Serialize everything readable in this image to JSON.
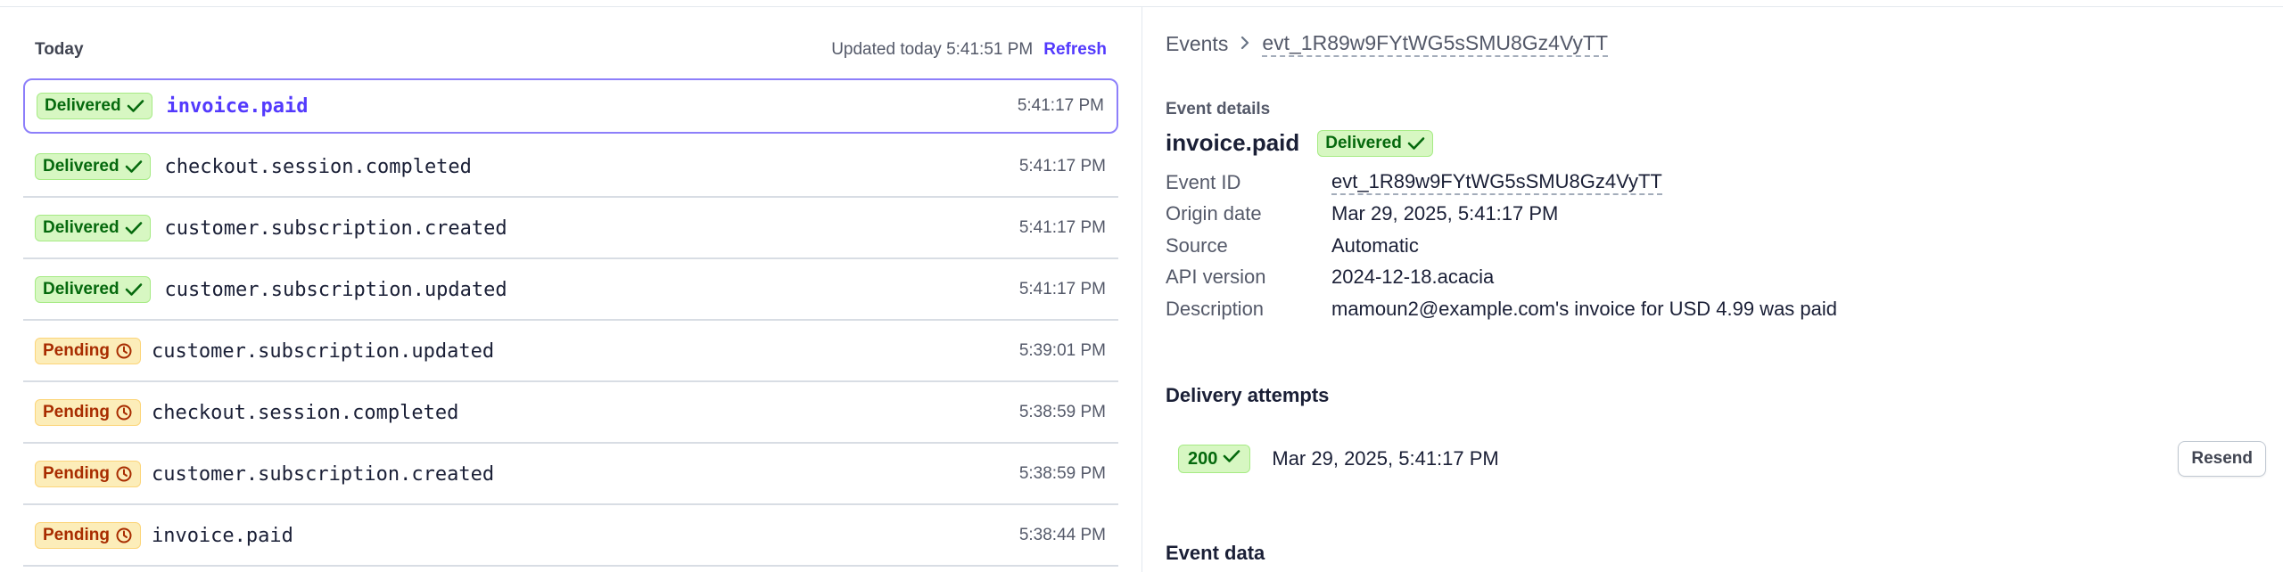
{
  "colors": {
    "accent": "#533afd",
    "delivered_bg": "#d7f7c2",
    "delivered_text": "#05690d",
    "pending_bg": "#fcedb9",
    "pending_text": "#a82c00",
    "selected_border": "#8d7ffa"
  },
  "list": {
    "section_title": "Today",
    "updated_text": "Updated today 5:41:51 PM",
    "refresh_label": "Refresh",
    "events": [
      {
        "status": "Delivered",
        "status_icon": "check-icon",
        "type": "invoice.paid",
        "time": "5:41:17 PM",
        "selected": true
      },
      {
        "status": "Delivered",
        "status_icon": "check-icon",
        "type": "checkout.session.completed",
        "time": "5:41:17 PM",
        "selected": false
      },
      {
        "status": "Delivered",
        "status_icon": "check-icon",
        "type": "customer.subscription.created",
        "time": "5:41:17 PM",
        "selected": false
      },
      {
        "status": "Delivered",
        "status_icon": "check-icon",
        "type": "customer.subscription.updated",
        "time": "5:41:17 PM",
        "selected": false
      },
      {
        "status": "Pending",
        "status_icon": "clock-icon",
        "type": "customer.subscription.updated",
        "time": "5:39:01 PM",
        "selected": false
      },
      {
        "status": "Pending",
        "status_icon": "clock-icon",
        "type": "checkout.session.completed",
        "time": "5:38:59 PM",
        "selected": false
      },
      {
        "status": "Pending",
        "status_icon": "clock-icon",
        "type": "customer.subscription.created",
        "time": "5:38:59 PM",
        "selected": false
      },
      {
        "status": "Pending",
        "status_icon": "clock-icon",
        "type": "invoice.paid",
        "time": "5:38:44 PM",
        "selected": false
      }
    ]
  },
  "detail": {
    "breadcrumb": {
      "events_label": "Events",
      "separator_icon": "chevron-right-icon",
      "event_id": "evt_1R89w9FYtWG5sSMU8Gz4VyTT"
    },
    "section_label": "Event details",
    "title": "invoice.paid",
    "status": "Delivered",
    "fields": {
      "event_id": {
        "label": "Event ID",
        "value": "evt_1R89w9FYtWG5sSMU8Gz4VyTT"
      },
      "origin_date": {
        "label": "Origin date",
        "value": "Mar 29, 2025, 5:41:17 PM"
      },
      "source": {
        "label": "Source",
        "value": "Automatic"
      },
      "api_version": {
        "label": "API version",
        "value": "2024-12-18.acacia"
      },
      "description": {
        "label": "Description",
        "value": "mamoun2@example.com's invoice for USD 4.99 was paid"
      }
    },
    "attempts": {
      "heading": "Delivery attempts",
      "items": [
        {
          "code": "200",
          "date": "Mar 29, 2025, 5:41:17 PM",
          "resend_label": "Resend"
        }
      ]
    },
    "event_data_heading": "Event data"
  }
}
